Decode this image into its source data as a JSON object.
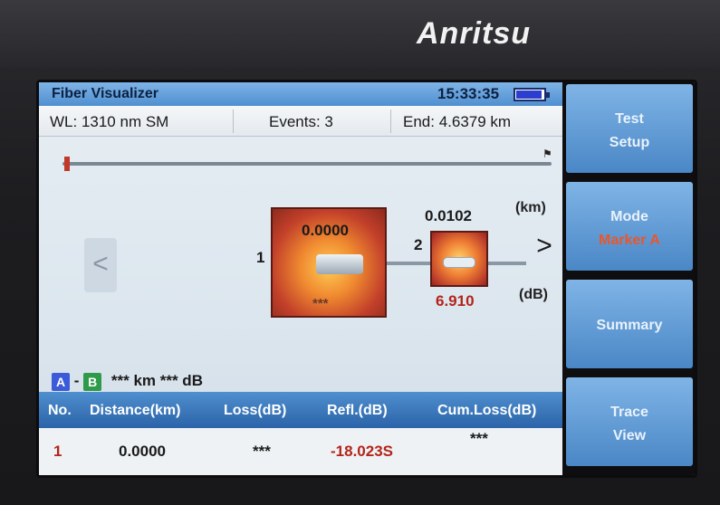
{
  "device": {
    "brand": "Anritsu"
  },
  "title_bar": {
    "title": "Fiber Visualizer",
    "time": "15:33:35"
  },
  "info_bar": {
    "wl": "WL: 1310 nm SM",
    "events": "Events: 3",
    "end": "End: 4.6379 km"
  },
  "trace": {
    "unit_km": "(km)",
    "unit_db": "(dB)",
    "nav_left": "<",
    "nav_right": ">"
  },
  "events": [
    {
      "number": "1",
      "distance": "0.0000",
      "loss": "***"
    },
    {
      "number": "2",
      "distance": "0.0102",
      "loss": "6.910"
    }
  ],
  "ab_marker": {
    "a": "A",
    "b": "B",
    "sep": "-",
    "text": "*** km *** dB"
  },
  "table": {
    "headers": [
      "No.",
      "Distance(km)",
      "Loss(dB)",
      "Refl.(dB)",
      "Cum.Loss(dB)"
    ],
    "rows": [
      {
        "no": "1",
        "distance": "0.0000",
        "loss": "***",
        "refl": "-18.023S",
        "cum": "***"
      }
    ]
  },
  "softkeys": [
    {
      "line1": "Test",
      "line2": "Setup"
    },
    {
      "line1": "Mode",
      "line2": "Marker A",
      "accent": "#e9572b"
    },
    {
      "line1": "Summary",
      "line2": ""
    },
    {
      "line1": "Trace",
      "line2": "View"
    }
  ]
}
